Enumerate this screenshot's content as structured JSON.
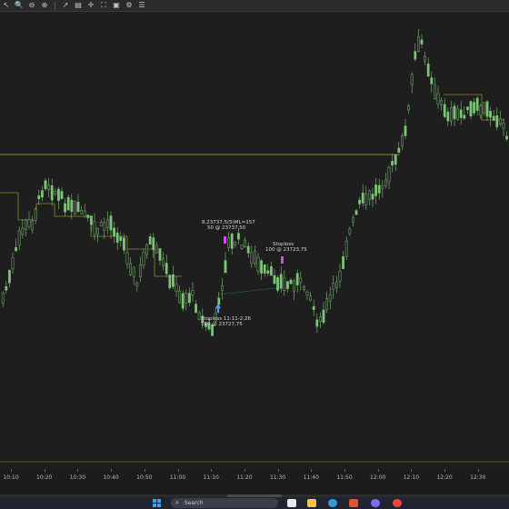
{
  "toolbar": {
    "icons": [
      "cursor-icon",
      "zoom-in-icon",
      "zoom-out-icon",
      "zoom-reset-icon",
      "arrow-tool-icon",
      "document-icon",
      "crosshair-icon",
      "fullscreen-icon",
      "image-icon",
      "settings-icon",
      "list-icon"
    ]
  },
  "colors": {
    "background": "#1e1e1e",
    "candle_up": "#7cc576",
    "candle_down": "#2a2a2a",
    "level_line": "#8a8a2a",
    "marker_buy": "#4aa3ff",
    "marker_sell": "#d946ef"
  },
  "chart_data": {
    "type": "candlestick",
    "x_axis_labels": [
      "10:10",
      "10:20",
      "10:30",
      "10:40",
      "10:50",
      "11:00",
      "11:10",
      "11:20",
      "11:30",
      "11:40",
      "11:50",
      "12:00",
      "12:10",
      "12:20",
      "12:30"
    ],
    "annotations": [
      {
        "lines": [
          "8,23737,5(5)ML=157",
          "50 @ 23737,50"
        ]
      },
      {
        "lines": [
          "Stoploss",
          "100 @ 23723,75"
        ]
      },
      {
        "lines": [
          "Stoploss 11:11-2,26",
          "100 @ 23727,75"
        ]
      }
    ]
  },
  "taskbar": {
    "search_placeholder": "Search",
    "apps": [
      "file-explorer-icon",
      "folder-icon",
      "edge-icon",
      "office-icon",
      "discord-icon",
      "chrome-icon"
    ]
  }
}
